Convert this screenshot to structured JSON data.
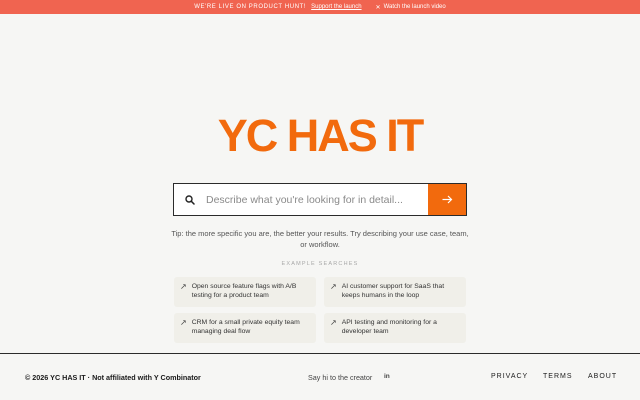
{
  "banner": {
    "text": "We're live on Product Hunt!",
    "support_link": "Support the launch",
    "video_link": "Watch the launch video"
  },
  "logo": "YC HAS IT",
  "search": {
    "placeholder": "Describe what you're looking for in detail..."
  },
  "tip": "Tip: the more specific you are, the better your results. Try describing your use case, team, or workflow.",
  "examples": {
    "label": "Example searches",
    "items": [
      "Open source feature flags with A/B testing for a product team",
      "AI customer support for SaaS that keeps humans in the loop",
      "CRM for a small private equity team managing deal flow",
      "API testing and monitoring for a developer team"
    ]
  },
  "footer": {
    "copyright": "© 2026 YC HAS IT · Not affiliated with Y Combinator",
    "say_hi": "Say hi to the creator",
    "linkedin": "in",
    "nav": [
      "Privacy",
      "Terms",
      "About"
    ]
  },
  "colors": {
    "banner": "#f06450",
    "accent": "#f26a0d",
    "background": "#f6f6f4"
  }
}
